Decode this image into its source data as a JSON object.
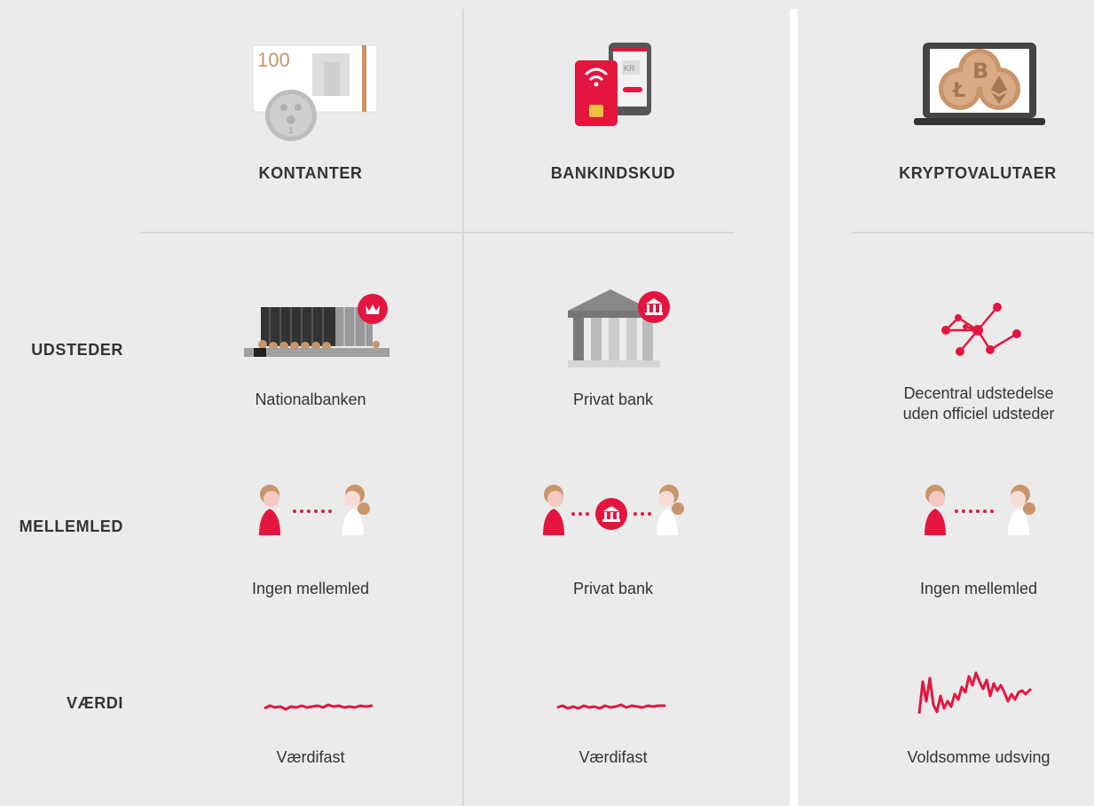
{
  "columns": {
    "cash": "KONTANTER",
    "bank_deposits": "BANKINDSKUD",
    "crypto": "KRYPTOVALUTAER"
  },
  "rows": {
    "issuer": "UDSTEDER",
    "intermediary": "MELLEMLED",
    "value": "VÆRDI"
  },
  "cells": {
    "cash_issuer": "Nationalbanken",
    "bank_issuer": "Privat bank",
    "crypto_issuer_line1": "Decentral udstedelse",
    "crypto_issuer_line2": "uden officiel udsteder",
    "cash_intermediary": "Ingen mellemled",
    "bank_intermediary": "Privat bank",
    "crypto_intermediary": "Ingen mellemled",
    "cash_value": "Værdifast",
    "bank_value": "Værdifast",
    "crypto_value": "Voldsomme udsving"
  },
  "icon_text": {
    "banknote_value": "100",
    "coin_value": "1",
    "phone_label": "KR"
  },
  "colors": {
    "accent_red": "#e4153f",
    "background": "#ebebeb",
    "text": "#333333",
    "gold": "#c8956b"
  }
}
